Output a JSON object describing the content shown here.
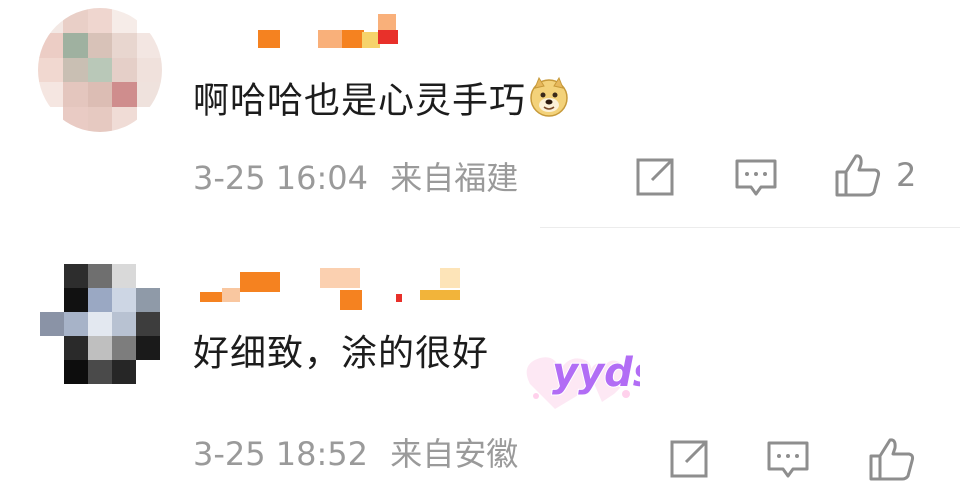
{
  "comments": [
    {
      "text": "啊哈哈也是心灵手巧",
      "emoji": "doge-emoji",
      "time": "3-25 16:04",
      "location": "来自福建",
      "like_count": "2"
    },
    {
      "text": "好细致，涂的很好",
      "sticker": "yyds",
      "time": "3-25 18:52",
      "location": "来自安徽",
      "like_count": ""
    }
  ],
  "icons": {
    "share": "share-icon",
    "comment": "comment-icon",
    "like": "thumbs-up-icon"
  },
  "colors": {
    "text": "#1c1c1c",
    "meta": "#9a9a9a",
    "username_orange": "#f58220",
    "sticker_purple": "#b26df5"
  }
}
